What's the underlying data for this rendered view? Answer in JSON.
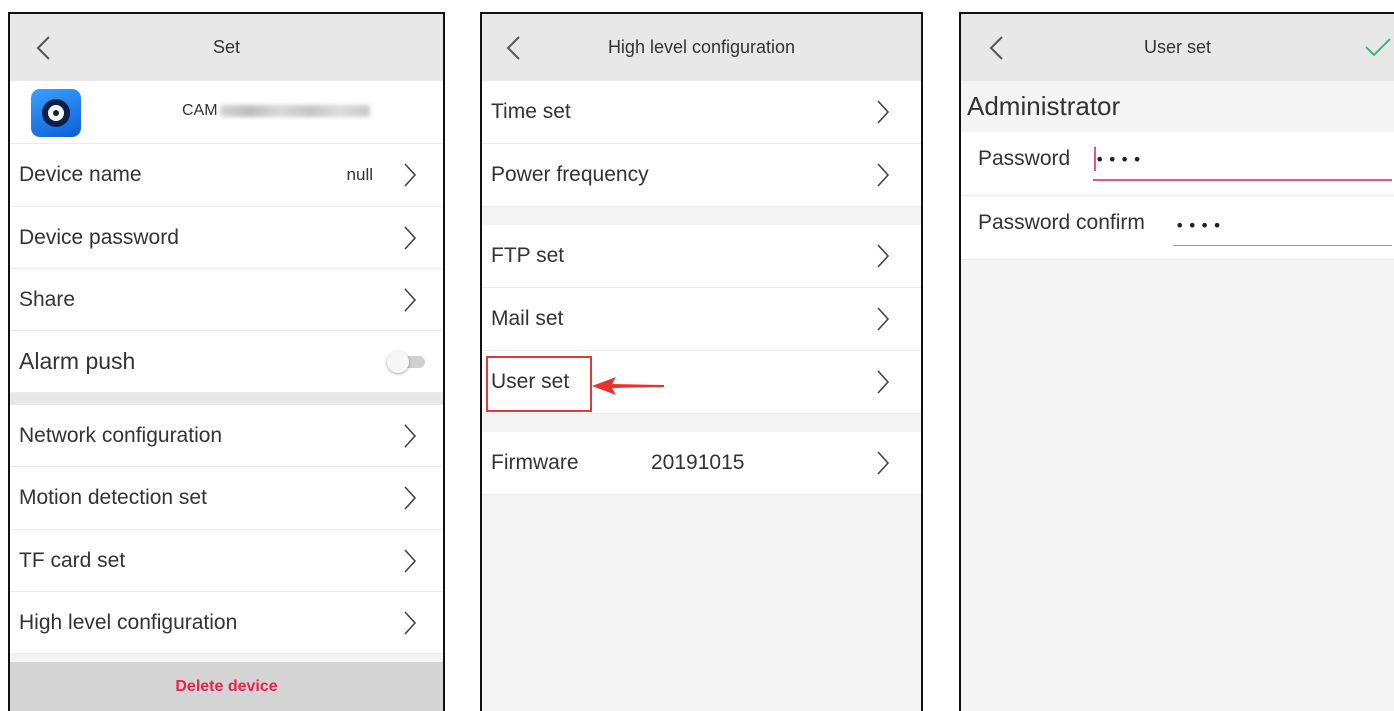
{
  "panel1": {
    "title": "Set",
    "device_id_prefix": "CAM",
    "rows": [
      {
        "label": "Device name",
        "value": "null"
      },
      {
        "label": "Device password"
      },
      {
        "label": "Share"
      },
      {
        "label": "Alarm push",
        "toggle": false
      },
      {
        "label": "Network configuration"
      },
      {
        "label": "Motion detection set"
      },
      {
        "label": "TF card set"
      },
      {
        "label": "High level configuration"
      }
    ],
    "delete_label": "Delete device"
  },
  "panel2": {
    "title": "High level configuration",
    "rows": [
      {
        "label": "Time set"
      },
      {
        "label": "Power frequency"
      },
      {
        "label": "FTP set"
      },
      {
        "label": "Mail set"
      },
      {
        "label": "User set"
      },
      {
        "label": "Firmware",
        "value": "20191015"
      }
    ],
    "highlight_color": "#e23a3a"
  },
  "panel3": {
    "title": "User set",
    "section": "Administrator",
    "password_label": "Password",
    "password_value": "1234",
    "confirm_label": "Password confirm",
    "confirm_value": "1234",
    "accent_color": "#e5548c",
    "check_color": "#3cb87a"
  },
  "icons": [
    "back-icon",
    "chevron-right-icon",
    "check-icon",
    "app-camera-icon",
    "toggle-switch",
    "red-arrow-icon"
  ]
}
